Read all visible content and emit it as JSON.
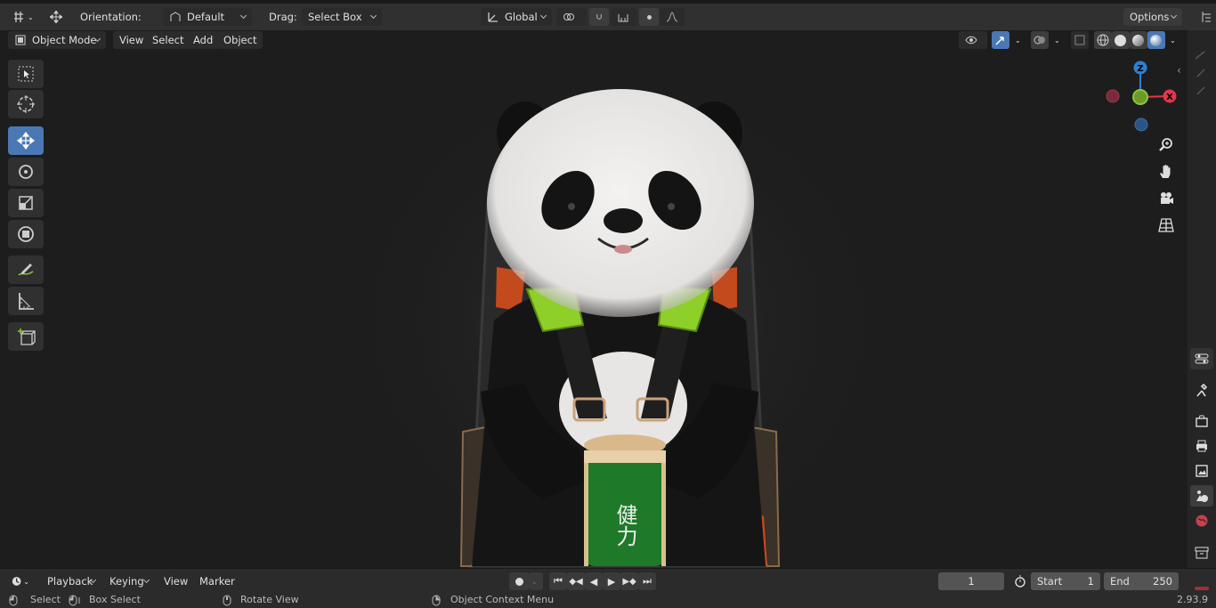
{
  "header": {
    "orientation_label": "Orientation:",
    "orientation_value": "Default",
    "drag_label": "Drag:",
    "drag_value": "Select Box",
    "transform_orientation": "Global",
    "options_label": "Options"
  },
  "viewport_header": {
    "mode": "Object Mode",
    "menus": [
      "View",
      "Select",
      "Add",
      "Object"
    ]
  },
  "gizmo": {
    "z": "Z",
    "x": "X"
  },
  "timeline": {
    "menus": [
      "Playback",
      "Keying",
      "View",
      "Marker"
    ],
    "current_frame": "1",
    "start_label": "Start",
    "start_value": "1",
    "end_label": "End",
    "end_value": "250"
  },
  "statusbar": {
    "select": "Select",
    "box_select": "Box Select",
    "rotate_view": "Rotate View",
    "context_menu": "Object Context Menu",
    "version": "2.93.9"
  },
  "colors": {
    "accent": "#4a78b5",
    "axis_x": "#e0374d",
    "axis_y": "#8bc53f",
    "axis_z": "#2e80d1"
  },
  "can_text": "健力"
}
